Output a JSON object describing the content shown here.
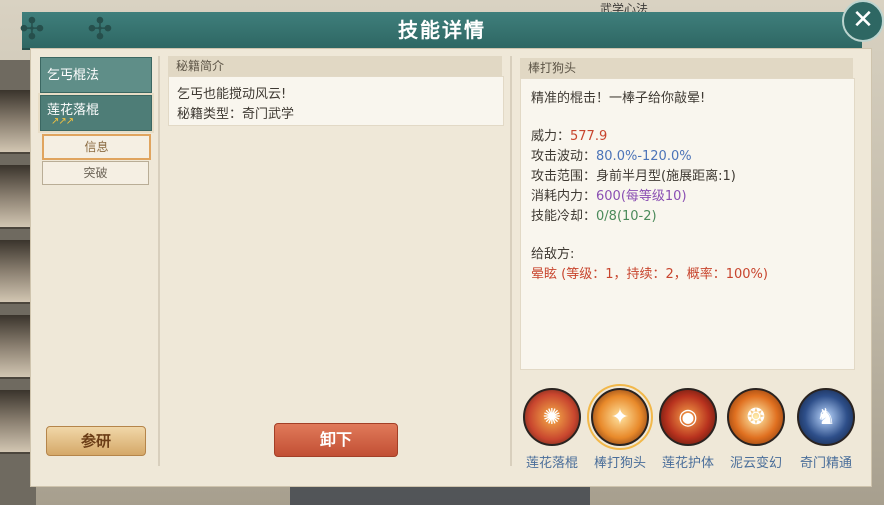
{
  "background": {
    "banner_text": "武学心法"
  },
  "header": {
    "title": "技能详情"
  },
  "left": {
    "tabs": [
      {
        "label": "乞丐棍法",
        "selected": false
      },
      {
        "label": "莲花落棍",
        "selected": true,
        "arrows": "↗↗↗"
      }
    ],
    "subtabs": [
      {
        "label": "信息",
        "selected": true
      },
      {
        "label": "突破",
        "selected": false
      }
    ],
    "study_button": "参研"
  },
  "middle": {
    "section_title": "秘籍简介",
    "line1": "乞丐也能搅动风云!",
    "line2": "秘籍类型：奇门武学",
    "unequip_button": "卸下"
  },
  "right": {
    "section_title": "棒打狗头",
    "desc": "精准的棍击！一棒子给你敲晕!",
    "stats": {
      "power_label": "威力：",
      "power_value": "577.9",
      "wave_label": "攻击波动：",
      "wave_value": "80.0%-120.0%",
      "range_label": "攻击范围：",
      "range_value": "身前半月型(施展距离:1)",
      "cost_label": "消耗内力：",
      "cost_value": "600",
      "cost_extra": "(每等级10)",
      "cd_label": "技能冷却：",
      "cd_value": "0/8(10-2)"
    },
    "enemy_label": "给敌方:",
    "enemy_effect": "晕眩 (等级：1，持续：2，概率：100%)"
  },
  "skills": [
    {
      "name": "莲花落棍",
      "icon": "fire-swirl-icon",
      "color": "#c8452e",
      "selected": false
    },
    {
      "name": "棒打狗头",
      "icon": "staff-strike-icon",
      "color": "#e8892a",
      "selected": true
    },
    {
      "name": "莲花护体",
      "icon": "red-vortex-icon",
      "color": "#b8321e",
      "selected": false
    },
    {
      "name": "泥云变幻",
      "icon": "orange-spiral-icon",
      "color": "#e07020",
      "selected": false
    },
    {
      "name": "奇门精通",
      "icon": "blue-figure-icon",
      "color": "#2e4f8a",
      "selected": false
    }
  ],
  "colors": {
    "teal_header": "#2e6763",
    "accent_red": "#c8452e",
    "accent_blue": "#4c74b8"
  }
}
